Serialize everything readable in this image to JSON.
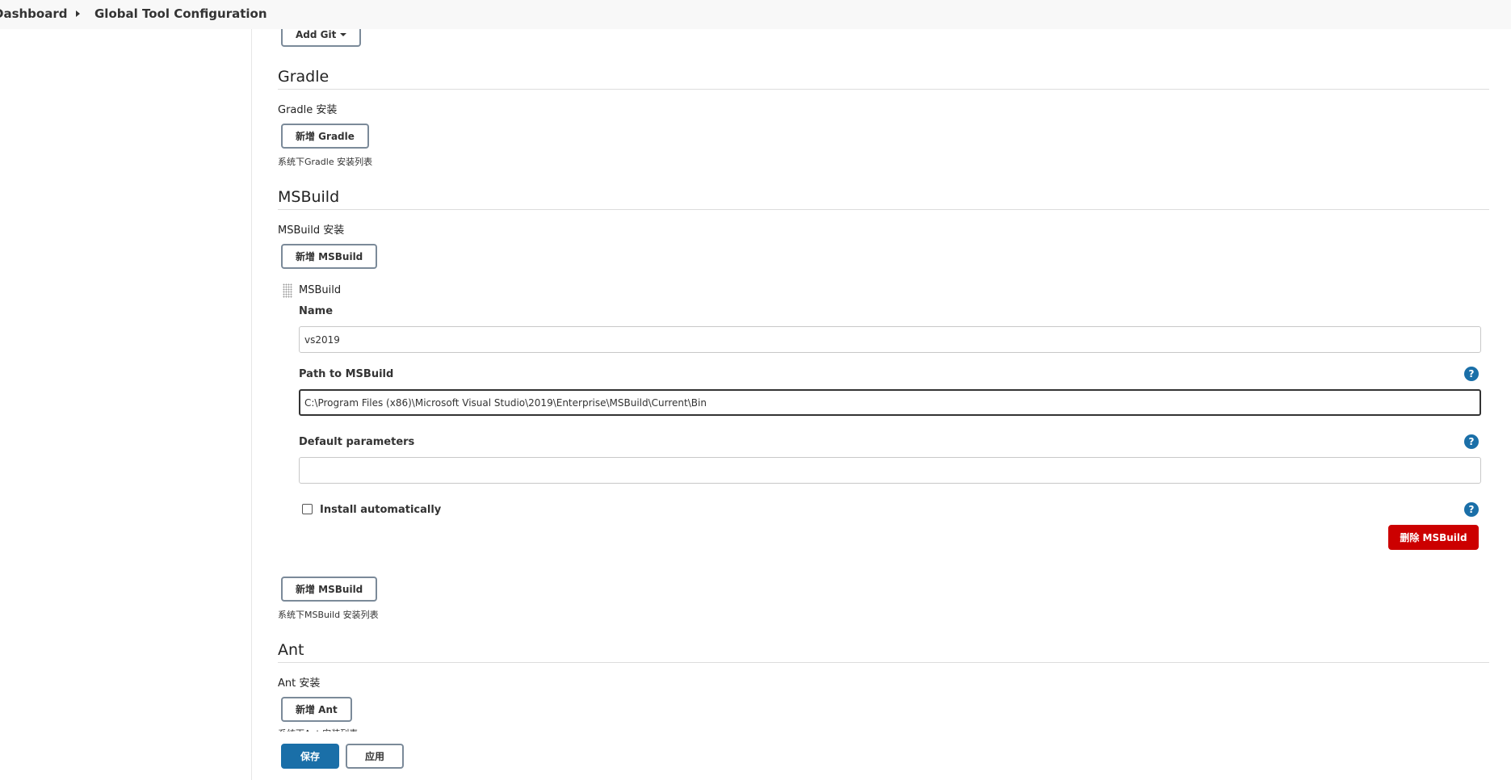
{
  "breadcrumb": {
    "items": [
      "Dashboard",
      "Global Tool Configuration"
    ]
  },
  "git": {
    "add_button": "Add Git"
  },
  "gradle": {
    "title": "Gradle",
    "installations_label": "Gradle 安装",
    "add_button": "新增 Gradle",
    "description": "系统下Gradle 安装列表"
  },
  "msbuild": {
    "title": "MSBuild",
    "installations_label": "MSBuild 安装",
    "add_button_top": "新增 MSBuild",
    "item": {
      "header": "MSBuild",
      "name_label": "Name",
      "name_value": "vs2019",
      "path_label": "Path to MSBuild",
      "path_value": "C:\\Program Files (x86)\\Microsoft Visual Studio\\2019\\Enterprise\\MSBuild\\Current\\Bin",
      "default_params_label": "Default parameters",
      "default_params_value": "",
      "install_auto_label": "Install automatically",
      "install_auto_checked": false,
      "delete_button": "删除 MSBuild"
    },
    "add_button_bottom": "新增 MSBuild",
    "description": "系统下MSBuild 安装列表"
  },
  "ant": {
    "title": "Ant",
    "installations_label": "Ant 安装",
    "add_button": "新增 Ant",
    "description": "系统下Ant 安装列表"
  },
  "footer": {
    "save_button": "保存",
    "apply_button": "应用"
  },
  "help_icon_glyph": "?",
  "colors": {
    "primary": "#1a6fa8",
    "danger": "#cc0000",
    "help": "#1a6fa8"
  }
}
